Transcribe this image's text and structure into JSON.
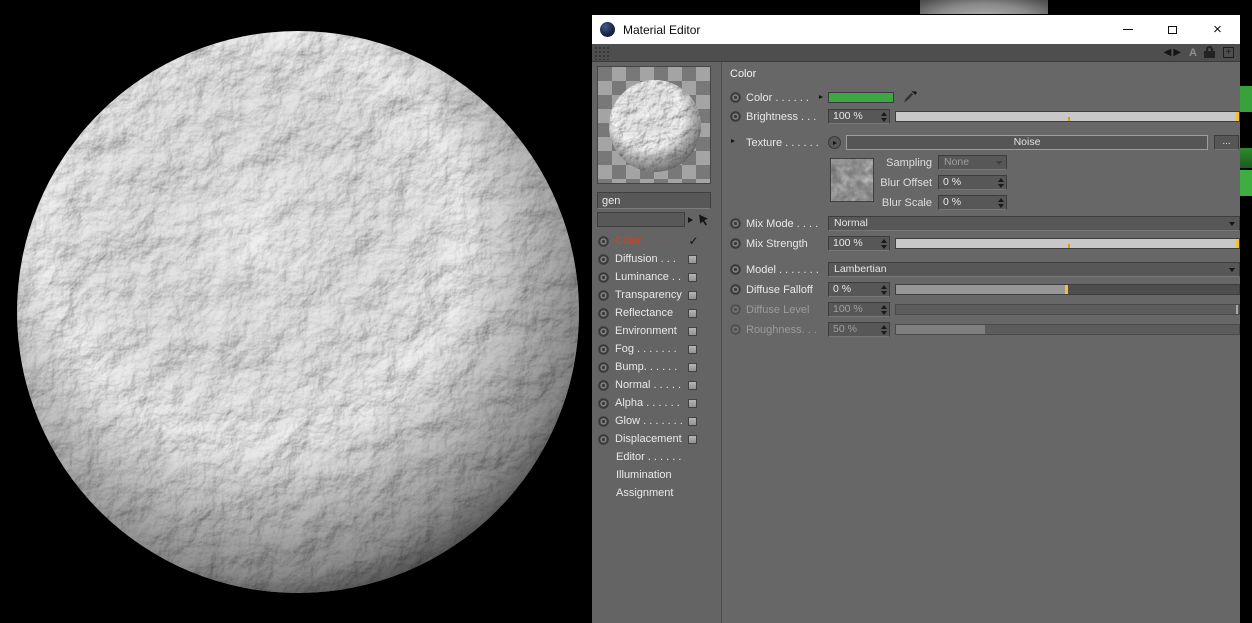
{
  "app": {
    "title": "Material Editor"
  },
  "titlebar": {
    "close_glyph": "×"
  },
  "toolbar": {
    "nav_left": "◀",
    "nav_right": "▶",
    "letter_a": "A",
    "plus_glyph": "+"
  },
  "preview": {
    "name_value": "gen"
  },
  "channels": {
    "check_glyph": "✓",
    "items": [
      {
        "label": "Color. . . . . ."
      },
      {
        "label": "Diffusion . . ."
      },
      {
        "label": "Luminance . ."
      },
      {
        "label": "Transparency"
      },
      {
        "label": "Reflectance"
      },
      {
        "label": "Environment"
      },
      {
        "label": "Fog . . . . . . ."
      },
      {
        "label": "Bump. . . . . ."
      },
      {
        "label": "Normal . . . . ."
      },
      {
        "label": "Alpha . . . . . ."
      },
      {
        "label": "Glow . . . . . . ."
      },
      {
        "label": "Displacement"
      }
    ],
    "pages": [
      "Editor . . . . . .",
      "Illumination",
      "Assignment"
    ]
  },
  "color_page": {
    "header": "Color",
    "color": {
      "label": "Color . . . . . .",
      "swatch": "#3fa646"
    },
    "brightness": {
      "label": "Brightness . . .",
      "value": "100 %",
      "pct": 100
    },
    "texture": {
      "label": "Texture . . . . . .",
      "button": "Noise",
      "more": "..."
    },
    "sampling": {
      "label": "Sampling",
      "value": "None"
    },
    "blur_offset": {
      "label": "Blur Offset",
      "value": "0 %"
    },
    "blur_scale": {
      "label": "Blur Scale",
      "value": "0 %"
    },
    "mix_mode": {
      "label": "Mix Mode . . . .",
      "value": "Normal"
    },
    "mix_strength": {
      "label": "Mix Strength",
      "value": "100 %",
      "pct": 100
    },
    "model": {
      "label": "Model . . . . . . .",
      "value": "Lambertian"
    },
    "diffuse_falloff": {
      "label": "Diffuse Falloff",
      "value": "0 %",
      "pct": 50
    },
    "diffuse_level": {
      "label": "Diffuse Level",
      "value": "100 %",
      "pct": 100
    },
    "roughness": {
      "label": "Roughness. . .",
      "value": "50 %",
      "pct": 26
    }
  },
  "colors": {
    "accent_green": "#3fa646",
    "slider_handle": "#f2c230"
  }
}
